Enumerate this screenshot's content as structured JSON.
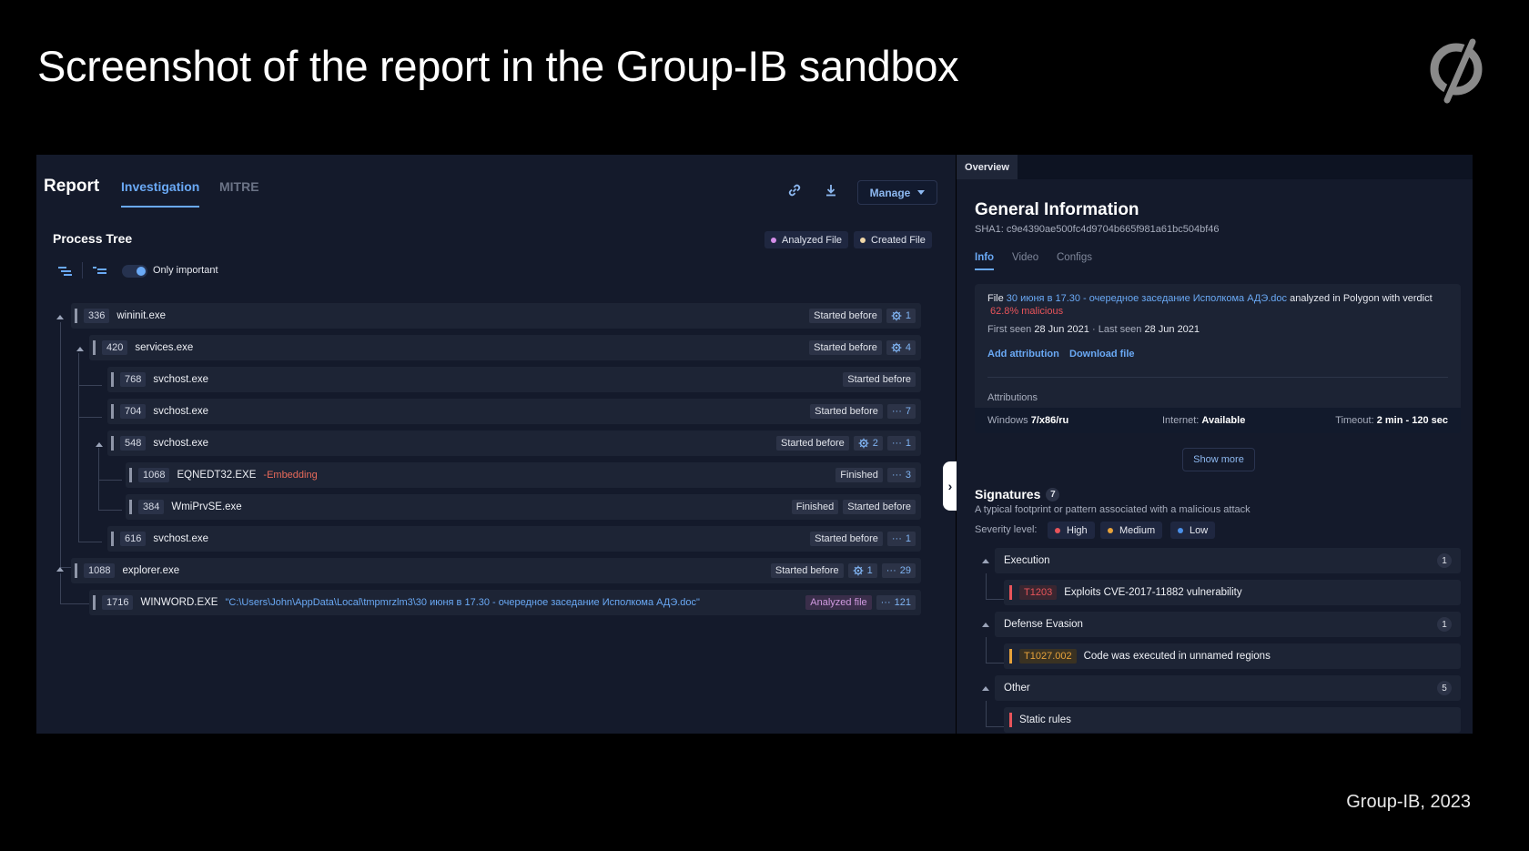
{
  "slide": {
    "title": "Screenshot of the report in the Group-IB sandbox",
    "footer": "Group-IB, 2023"
  },
  "report": {
    "title": "Report",
    "tabs": [
      {
        "label": "Investigation",
        "active": true
      },
      {
        "label": "MITRE",
        "active": false
      }
    ],
    "manage_label": "Manage",
    "process_tree_title": "Process Tree",
    "legend": [
      {
        "label": "Analyzed File",
        "color": "#d48ee8"
      },
      {
        "label": "Created File",
        "color": "#f0d7a8"
      }
    ],
    "only_important_label": "Only important",
    "rows": [
      {
        "pid": "336",
        "name": "wininit.exe",
        "badges": [
          "Started before"
        ],
        "counts": [
          {
            "icon": "gear-icon",
            "value": "1"
          }
        ]
      },
      {
        "pid": "420",
        "name": "services.exe",
        "badges": [
          "Started before"
        ],
        "counts": [
          {
            "icon": "gear-icon",
            "value": "4"
          }
        ]
      },
      {
        "pid": "768",
        "name": "svchost.exe",
        "badges": [
          "Started before"
        ],
        "counts": []
      },
      {
        "pid": "704",
        "name": "svchost.exe",
        "badges": [
          "Started before"
        ],
        "counts": [
          {
            "icon": "more-icon",
            "value": "7"
          }
        ]
      },
      {
        "pid": "548",
        "name": "svchost.exe",
        "badges": [
          "Started before"
        ],
        "counts": [
          {
            "icon": "gear-icon",
            "value": "2"
          },
          {
            "icon": "more-icon",
            "value": "1"
          }
        ]
      },
      {
        "pid": "1068",
        "name": "EQNEDT32.EXE",
        "extra": "-Embedding",
        "badges": [
          "Finished"
        ],
        "counts": [
          {
            "icon": "more-icon",
            "value": "3"
          }
        ]
      },
      {
        "pid": "384",
        "name": "WmiPrvSE.exe",
        "badges": [
          "Finished",
          "Started before"
        ],
        "counts": []
      },
      {
        "pid": "616",
        "name": "svchost.exe",
        "badges": [
          "Started before"
        ],
        "counts": [
          {
            "icon": "more-icon",
            "value": "1"
          }
        ]
      },
      {
        "pid": "1088",
        "name": "explorer.exe",
        "badges": [
          "Started before"
        ],
        "counts": [
          {
            "icon": "gear-icon",
            "value": "1"
          },
          {
            "icon": "more-icon",
            "value": "29"
          }
        ]
      },
      {
        "pid": "1716",
        "name": "WINWORD.EXE",
        "extra": "\"C:\\Users\\John\\AppData\\Local\\tmpmrzlm3\\30 июня в 17.30 - очередное заседание Исполкома АДЭ.doc\"",
        "badges": [
          "Analyzed file"
        ],
        "counts": [
          {
            "icon": "more-icon",
            "value": "121"
          }
        ]
      }
    ]
  },
  "overview": {
    "tab_label": "Overview",
    "title": "General Information",
    "sha1": "SHA1: c9e4390ae500fc4d9704b665f981a61bc504bf46",
    "sub_tabs": [
      {
        "label": "Info",
        "active": true
      },
      {
        "label": "Video",
        "active": false
      },
      {
        "label": "Configs",
        "active": false
      }
    ],
    "file_prefix": "File",
    "file_name": "30 июня в 17.30 - очередное заседание Исполкома АДЭ.doc",
    "file_suffix": "analyzed in Polygon with verdict",
    "verdict": "62.8% malicious",
    "first_seen_label": "First seen",
    "first_seen": "28 Jun 2021",
    "separator": "·",
    "last_seen_label": "Last seen",
    "last_seen": "28 Jun 2021",
    "add_attribution": "Add attribution",
    "download_file": "Download file",
    "attributions_label": "Attributions",
    "windows_label": "Windows",
    "windows_value": "7/x86/ru",
    "internet_label": "Internet:",
    "internet_value": "Available",
    "timeout_label": "Timeout:",
    "timeout_value": "2 min - 120 sec",
    "show_more": "Show more",
    "signatures_title": "Signatures",
    "signatures_count": "7",
    "signatures_desc": "A typical footprint or pattern associated with a malicious attack",
    "severity_label": "Severity level:",
    "severity_levels": [
      {
        "label": "High",
        "color": "#e8545a"
      },
      {
        "label": "Medium",
        "color": "#e7a23a"
      },
      {
        "label": "Low",
        "color": "#4a8fe8"
      }
    ],
    "groups": [
      {
        "name": "Execution",
        "count": "1",
        "item": {
          "code": "T1203",
          "text": "Exploits CVE-2017-11882 vulnerability",
          "severity": "high"
        }
      },
      {
        "name": "Defense Evasion",
        "count": "1",
        "item": {
          "code": "T1027.002",
          "text": "Code was executed in unnamed regions",
          "severity": "medium"
        }
      },
      {
        "name": "Other",
        "count": "5",
        "item": {
          "code": "",
          "text": "Static rules",
          "severity": "high"
        }
      }
    ]
  }
}
